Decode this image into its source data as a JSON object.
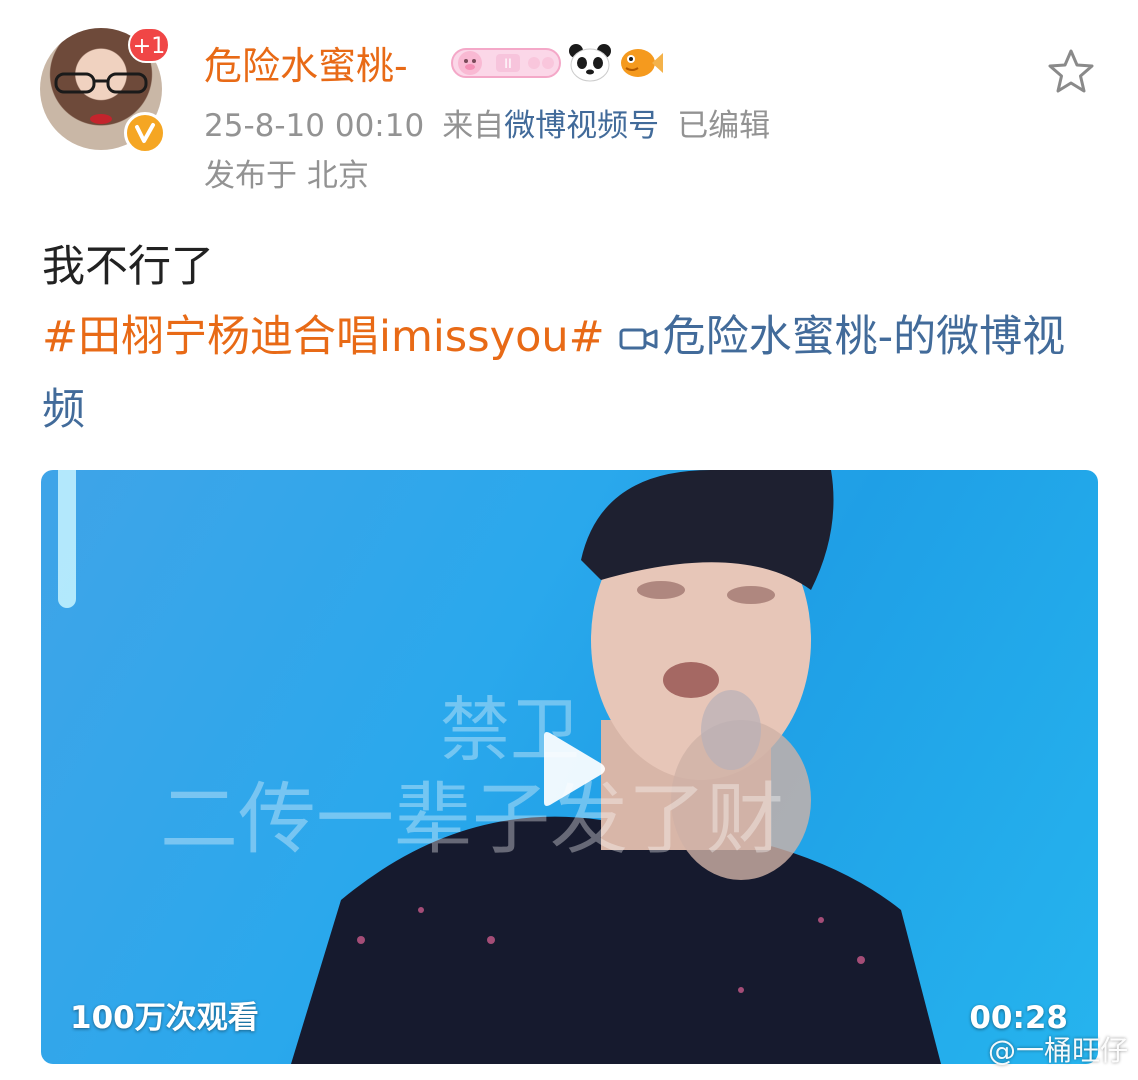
{
  "header": {
    "notification_badge": "+1",
    "username": "危险水蜜桃-",
    "user_emojis": [
      "pig-badge",
      "panda-emoji",
      "goldfish-emoji"
    ],
    "timestamp": "25-8-10 00:10",
    "source_prefix": "来自",
    "source_name": "微博视频号",
    "edited_label": "已编辑",
    "location": "发布于 北京"
  },
  "post": {
    "text": "我不行了",
    "hashtag": "#田栩宁杨迪合唱imissyou#",
    "video_link_text": "危险水蜜桃-的微博视频"
  },
  "video": {
    "subtitle_line1": "禁卫",
    "subtitle_line2": "二传一辈子发了财",
    "view_count": "100万次观看",
    "duration": "00:28"
  },
  "watermark": {
    "text": "@一桶旺仔"
  },
  "colors": {
    "username": "#e86a16",
    "hashtag": "#e86a16",
    "link": "#426b9a",
    "meta": "#939393",
    "badge_red": "#f04646",
    "verified_orange": "#f5a623"
  }
}
